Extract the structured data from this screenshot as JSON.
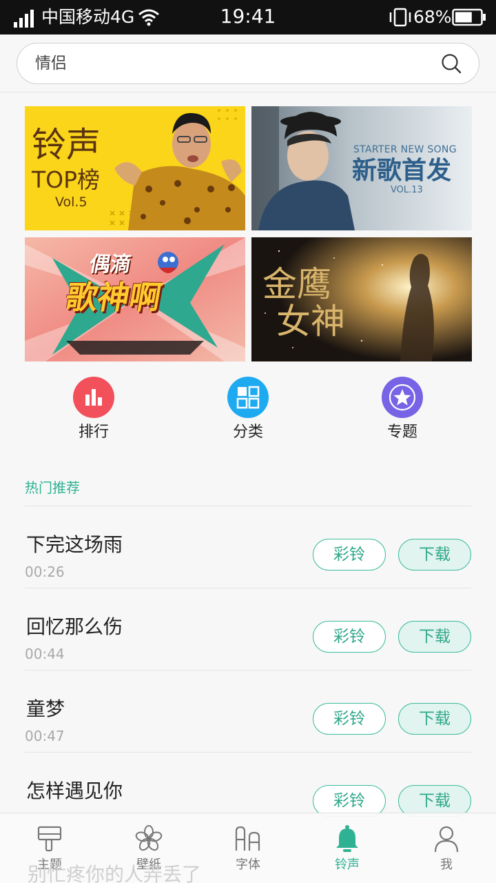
{
  "status_bar": {
    "carrier": "中国移动4G",
    "time": "19:41",
    "battery": "68%",
    "battery_level": 0.68
  },
  "search": {
    "value": "情侣"
  },
  "banners": [
    {
      "title": "铃声",
      "subtitle": "TOP榜",
      "vol": "Vol.5"
    },
    {
      "en": "STARTER NEW SONG",
      "title": "新歌首发",
      "vol": "VOL.13"
    },
    {
      "line1": "偶滴",
      "line2": "歌神啊"
    },
    {
      "line1": "金鹰",
      "line2": "女神"
    }
  ],
  "categories": [
    {
      "label": "排行",
      "icon": "bar-chart-icon",
      "color": "#f2505b"
    },
    {
      "label": "分类",
      "icon": "grid-icon",
      "color": "#1eaaf1"
    },
    {
      "label": "专题",
      "icon": "star-icon",
      "color": "#7763e6"
    }
  ],
  "section": {
    "title": "热门推荐"
  },
  "songs": [
    {
      "title": "下完这场雨",
      "duration": "00:26",
      "ring_label": "彩铃",
      "download_label": "下载"
    },
    {
      "title": "回忆那么伤",
      "duration": "00:44",
      "ring_label": "彩铃",
      "download_label": "下载"
    },
    {
      "title": "童梦",
      "duration": "00:47",
      "ring_label": "彩铃",
      "download_label": "下载"
    },
    {
      "title": "怎样遇见你",
      "duration": "",
      "ring_label": "彩铃",
      "download_label": "下载"
    }
  ],
  "partial_song": {
    "title": "别忙疼你的人弄丢了"
  },
  "bottom_nav": [
    {
      "label": "主题",
      "icon": "paint-roller-icon",
      "active": false
    },
    {
      "label": "壁纸",
      "icon": "flower-icon",
      "active": false
    },
    {
      "label": "字体",
      "icon": "font-icon",
      "active": false
    },
    {
      "label": "铃声",
      "icon": "bell-icon",
      "active": true
    },
    {
      "label": "我",
      "icon": "person-icon",
      "active": false
    }
  ],
  "colors": {
    "accent": "#2fb293",
    "status_bar_bg": "#111111",
    "background": "#f7f7f7"
  }
}
